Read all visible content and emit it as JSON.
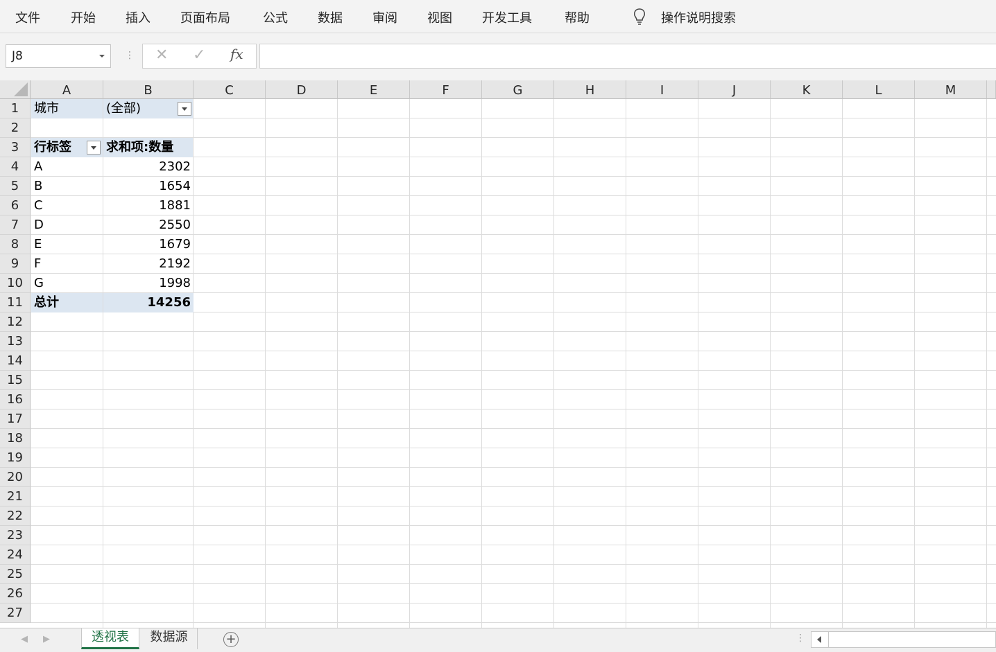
{
  "menu": {
    "items": [
      "文件",
      "开始",
      "插入",
      "页面布局",
      "公式",
      "数据",
      "审阅",
      "视图",
      "开发工具",
      "帮助"
    ],
    "tell_me": "操作说明搜索"
  },
  "formula_bar": {
    "name_box": "J8",
    "cancel": "✕",
    "enter": "✓",
    "fx": "fx",
    "content": ""
  },
  "columns": [
    "A",
    "B",
    "C",
    "D",
    "E",
    "F",
    "G",
    "H",
    "I",
    "J",
    "K",
    "L",
    "M"
  ],
  "rows": [
    "1",
    "2",
    "3",
    "4",
    "5",
    "6",
    "7",
    "8",
    "9",
    "10",
    "11",
    "12",
    "13",
    "14",
    "15",
    "16",
    "17",
    "18",
    "19",
    "20",
    "21",
    "22",
    "23",
    "24",
    "25",
    "26",
    "27"
  ],
  "pivot": {
    "filter_label": "城市",
    "filter_value": "(全部)",
    "row_label_header": "行标签",
    "value_header": "求和项:数量",
    "items": [
      {
        "label": "A",
        "value": "2302"
      },
      {
        "label": "B",
        "value": "1654"
      },
      {
        "label": "C",
        "value": "1881"
      },
      {
        "label": "D",
        "value": "2550"
      },
      {
        "label": "E",
        "value": "1679"
      },
      {
        "label": "F",
        "value": "2192"
      },
      {
        "label": "G",
        "value": "1998"
      }
    ],
    "total_label": "总计",
    "total_value": "14256"
  },
  "sheets": {
    "active": "透视表",
    "other": "数据源",
    "add": "+"
  }
}
